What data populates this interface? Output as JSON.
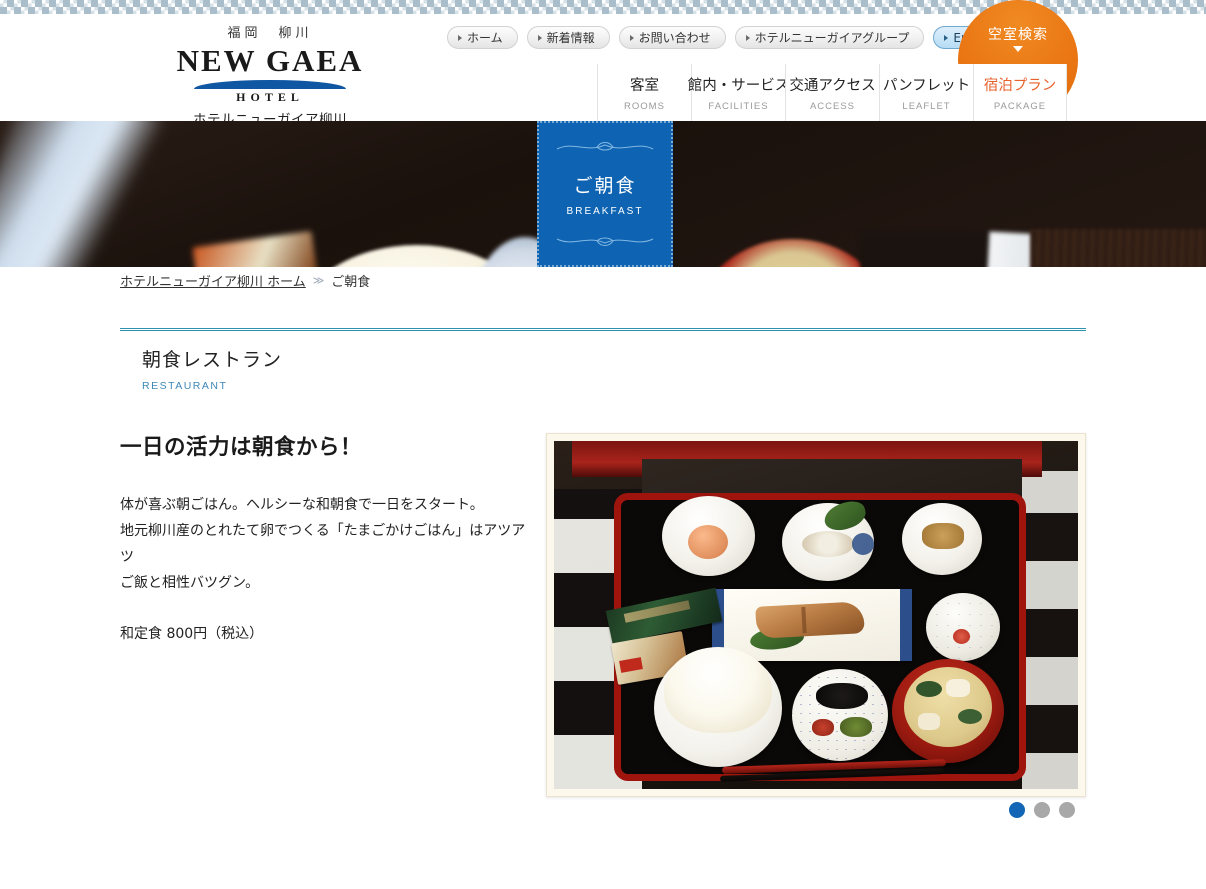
{
  "site": {
    "location": "福岡　柳川",
    "brand": "NEW GAEA",
    "brand_sub": "HOTEL",
    "brand_jp": "ホテルニューガイア柳川"
  },
  "header": {
    "top_links": [
      {
        "label": "ホーム",
        "icon": "triangle-right-icon"
      },
      {
        "label": "新着情報",
        "icon": "triangle-right-icon"
      },
      {
        "label": "お問い合わせ",
        "icon": "triangle-right-icon"
      },
      {
        "label": "ホテルニューガイアグループ",
        "icon": "triangle-right-icon"
      },
      {
        "label": "English",
        "icon": "triangle-right-icon"
      }
    ],
    "vacancy_button": {
      "label": "空室検索",
      "icon": "chevron-down-icon",
      "color": "#e97412"
    },
    "main_nav": [
      {
        "jp": "客室",
        "en": "ROOMS"
      },
      {
        "jp": "館内・サービス",
        "en": "FACILITIES"
      },
      {
        "jp": "交通アクセス",
        "en": "ACCESS"
      },
      {
        "jp": "パンフレット",
        "en": "LEAFLET"
      },
      {
        "jp": "宿泊プラン",
        "en": "PACKAGE",
        "accent": true
      }
    ],
    "accent_color": "#e8602c"
  },
  "hero": {
    "badge_jp": "ご朝食",
    "badge_en": "BREAKFAST",
    "badge_color": "#0e64b2"
  },
  "breadcrumb": {
    "home": "ホテルニューガイア柳川 ホーム",
    "separator": "≫",
    "current": "ご朝食"
  },
  "section": {
    "title_jp": "朝食レストラン",
    "title_en": "RESTAURANT",
    "rule_color": "#2f93ad"
  },
  "main": {
    "heading": "一日の活力は朝食から！",
    "paragraph_line1": "体が喜ぶ朝ごはん。ヘルシーな和朝食で一日をスタート。",
    "paragraph_line2": "地元柳川産のとれたて卵でつくる「たまごかけごはん」はアツアツ",
    "paragraph_line3": "ご飯と相性バツグン。",
    "price": "和定食 800円（税込）",
    "photo_alt": "和定食の朝食トレイ"
  },
  "slider": {
    "dots": [
      {
        "active": true
      },
      {
        "active": false
      },
      {
        "active": false
      }
    ],
    "active_color": "#1266b5",
    "inactive_color": "#a8a8a8"
  }
}
